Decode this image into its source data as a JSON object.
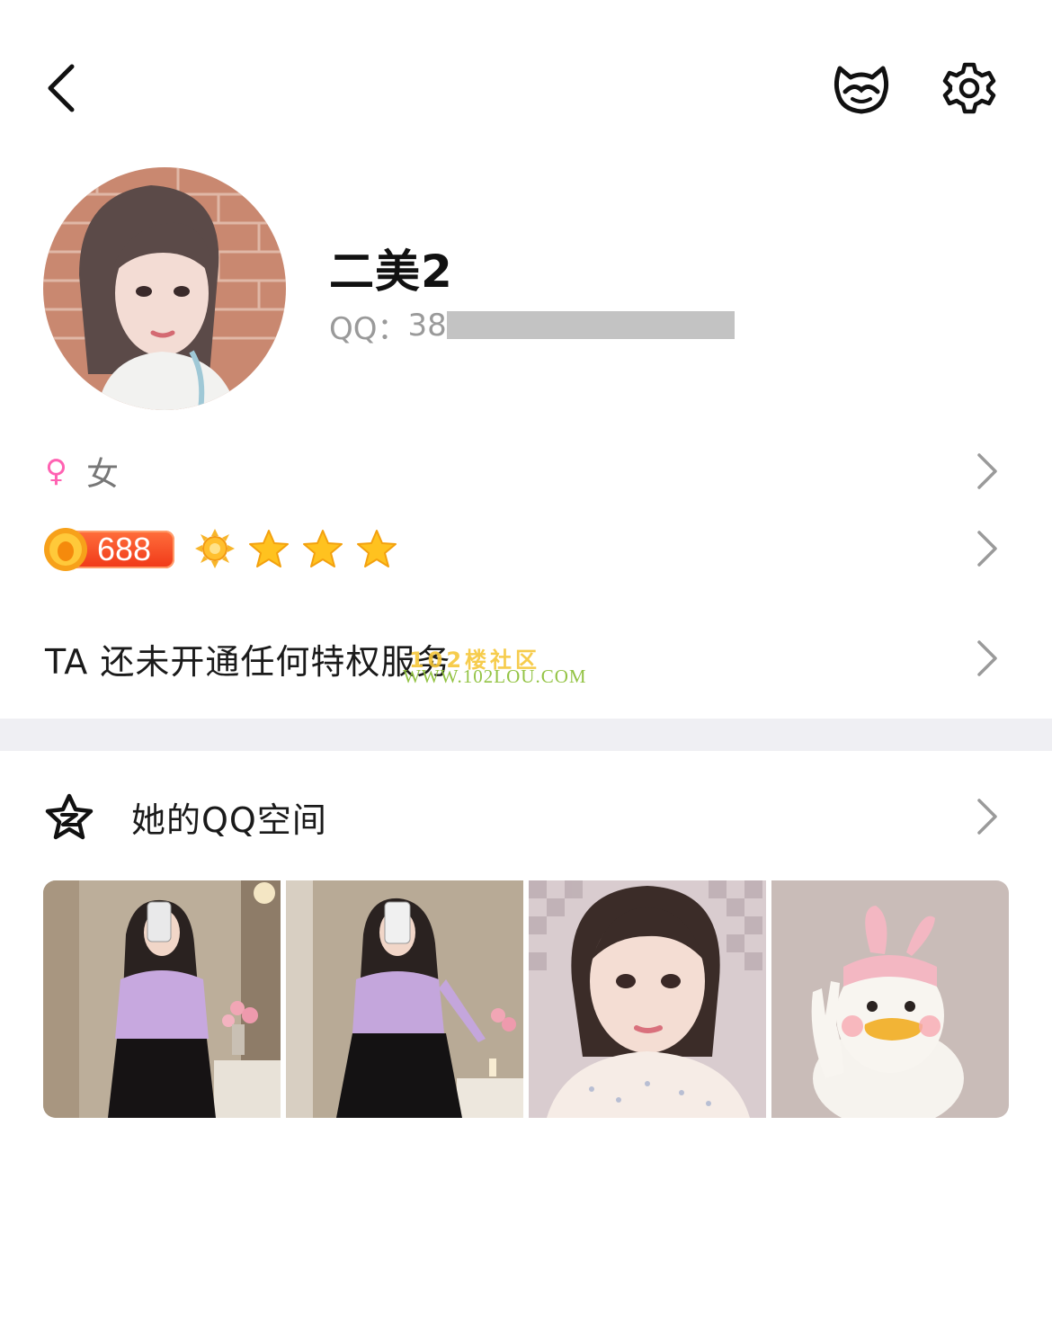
{
  "header": {
    "back_icon": "chevron-left-icon",
    "mask_icon": "mask-icon",
    "settings_icon": "gear-icon"
  },
  "profile": {
    "nickname": "二美2",
    "qq_label": "QQ：",
    "qq_visible_digits": "38"
  },
  "info": {
    "gender_symbol": "♀",
    "gender": "女",
    "level_value": "688",
    "level_icons": [
      "sun-icon",
      "star-icon",
      "star-icon",
      "star-icon"
    ],
    "privilege_text": "TA 还未开通任何特权服务"
  },
  "watermark": {
    "line1": "102楼社区",
    "line2": "WWW.102LOU.COM"
  },
  "qzone": {
    "label": "她的QQ空间",
    "photos": [
      "photo-1",
      "photo-2",
      "photo-3",
      "photo-4"
    ]
  },
  "colors": {
    "accent_pink": "#ff62b2",
    "coin_orange": "#f03818",
    "divider": "#efeff3",
    "secondary_text": "#9a9a9a"
  }
}
